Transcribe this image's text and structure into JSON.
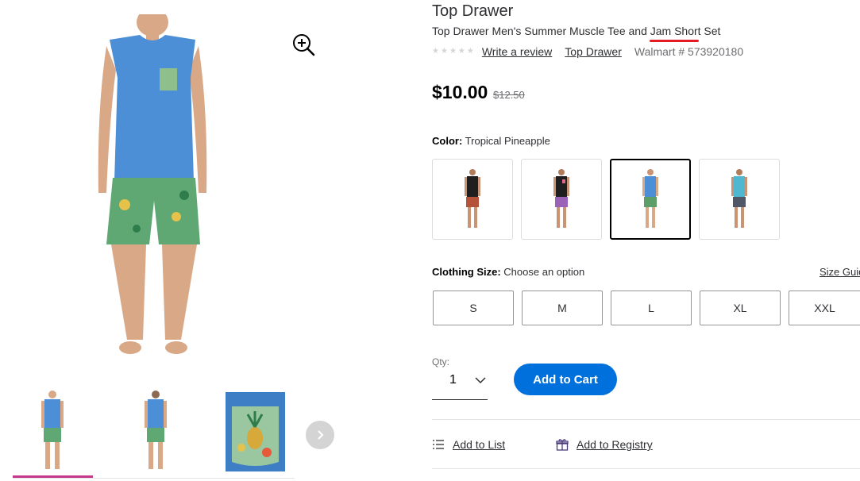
{
  "media": {
    "main_image_icon": "product-photo-man-tank-tropical-shorts",
    "zoom_icon": "zoom-in-icon",
    "thumbnails": [
      {
        "icon": "thumb-front-view"
      },
      {
        "icon": "thumb-back-view"
      },
      {
        "icon": "thumb-pocket-closeup"
      }
    ],
    "next_icon": "chevron-right-icon"
  },
  "product": {
    "brand": "Top Drawer",
    "title": "Top Drawer Men's Summer Muscle Tee and Jam Short Set",
    "write_review": "Write a review",
    "brand_link": "Top Drawer",
    "walmart_number": "Walmart # 573920180",
    "rating_stars": 0,
    "price": "$10.00",
    "was_price": "$12.50"
  },
  "color": {
    "label": "Color:",
    "selected": "Tropical Pineapple",
    "swatches": [
      {
        "name": "black-tank-red-shorts",
        "tank": "#1f1f1f",
        "shorts": "#b5533a"
      },
      {
        "name": "black-tank-purple-shorts",
        "tank": "#1f1f1f",
        "shorts": "#9a63b8"
      },
      {
        "name": "blue-tank-tropical-shorts",
        "tank": "#4d8fd6",
        "shorts": "#5b9e6a"
      },
      {
        "name": "teal-tank-grey-shorts",
        "tank": "#4fb7cf",
        "shorts": "#4e5866"
      }
    ],
    "selected_index": 2
  },
  "size": {
    "label": "Clothing Size:",
    "prompt": "Choose an option",
    "guide_link": "Size Guide",
    "options": [
      "S",
      "M",
      "L",
      "XL",
      "XXL"
    ]
  },
  "purchase": {
    "qty_label": "Qty:",
    "qty_value": "1",
    "add_to_cart": "Add to Cart"
  },
  "actions": {
    "add_to_list": "Add to List",
    "add_to_registry": "Add to Registry"
  },
  "colors": {
    "accent_blue": "#0071dc",
    "selected_thumb_bar": "#c5388b",
    "annotation_red": "#e51b23"
  }
}
